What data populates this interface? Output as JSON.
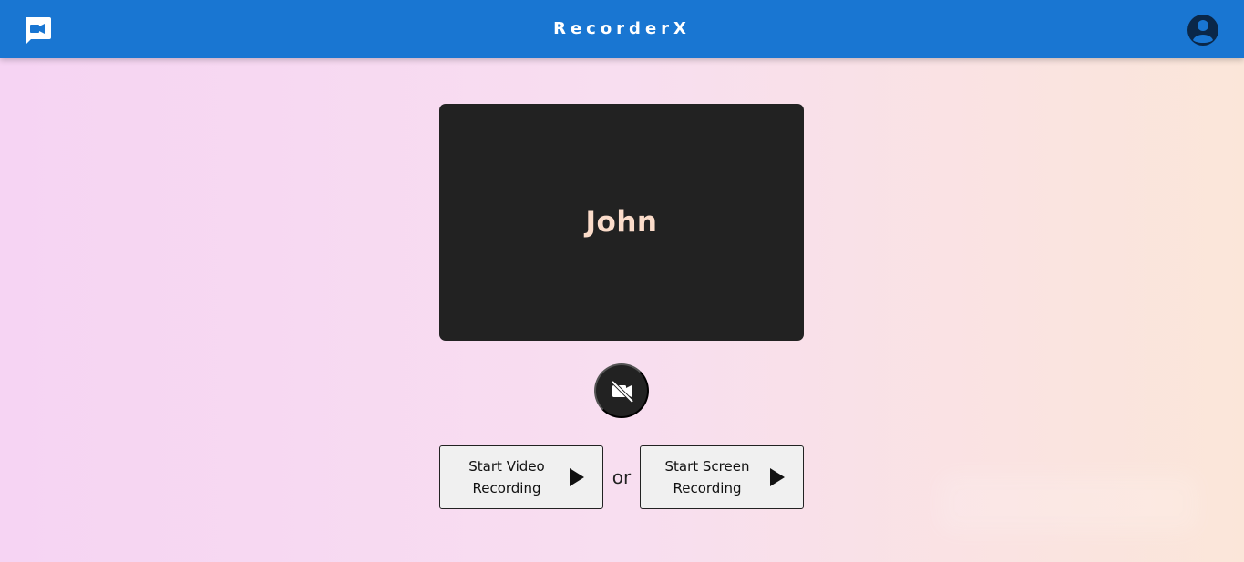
{
  "app": {
    "name": "RecorderX",
    "brand_color": "#1976d2",
    "logo_icon": "video-chat-icon",
    "account_icon": "account-circle-icon"
  },
  "preview": {
    "name": "John",
    "background_color": "#222222",
    "text_color": "#fbdcca"
  },
  "controls": {
    "camera_toggle_icon": "video-off-icon",
    "video_button_label": "Start Video Recording",
    "screen_button_label": "Start Screen Recording",
    "separator_text": "or",
    "play_icon": "play-icon"
  },
  "colors": {
    "background_start": "#f6d4f3",
    "background_end": "#fbe6d9",
    "button_fill": "#f0f0f0",
    "button_border": "#222222"
  }
}
